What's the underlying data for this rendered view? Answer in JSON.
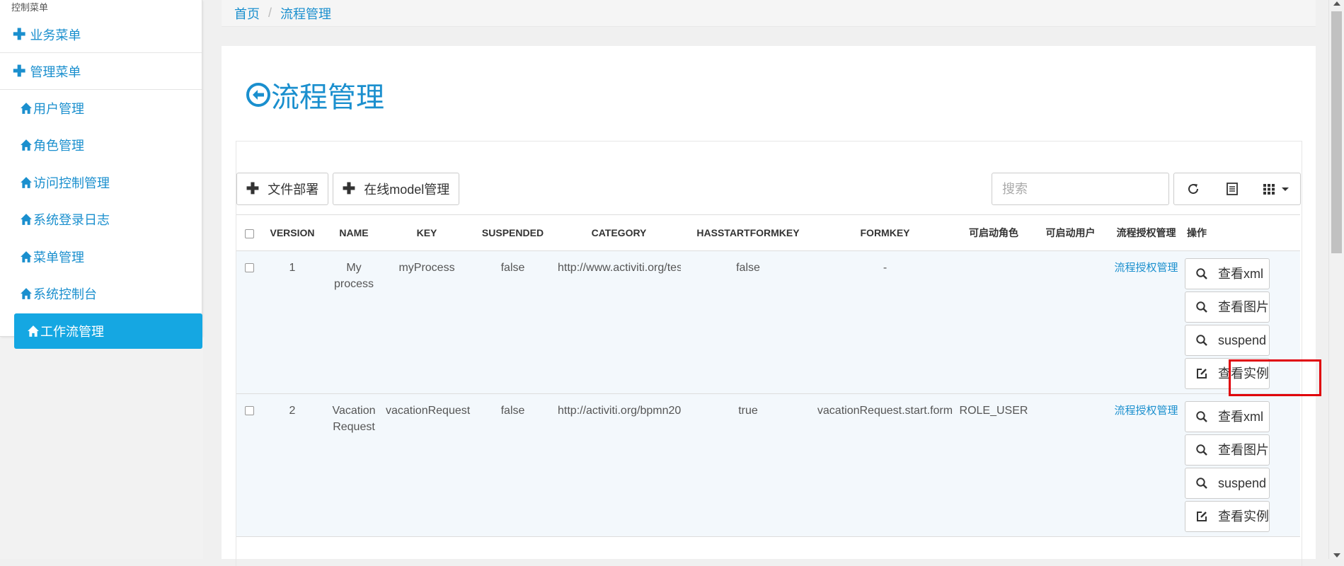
{
  "sidebar": {
    "caption": "控制菜单",
    "groups": [
      {
        "label": "业务菜单"
      },
      {
        "label": "管理菜单"
      }
    ],
    "items": [
      {
        "label": "用户管理"
      },
      {
        "label": "角色管理"
      },
      {
        "label": "访问控制管理"
      },
      {
        "label": "系统登录日志"
      },
      {
        "label": "菜单管理"
      },
      {
        "label": "系统控制台"
      },
      {
        "label": "工作流管理",
        "active": true
      }
    ]
  },
  "breadcrumb": {
    "home": "首页",
    "separator": "/",
    "current": "流程管理"
  },
  "page": {
    "title": "流程管理",
    "title_icon": "circle-arrow-left-icon"
  },
  "toolbar": {
    "deploy_label": "文件部署",
    "model_label": "在线model管理",
    "search_placeholder": "搜索",
    "refresh_icon": "refresh-icon",
    "toggle_view_icon": "list-view-icon",
    "columns_icon": "columns-grid-icon"
  },
  "table": {
    "columns": [
      "VERSION",
      "NAME",
      "KEY",
      "SUSPENDED",
      "CATEGORY",
      "HASSTARTFORMKEY",
      "FORMKEY",
      "可启动角色",
      "可启动用户",
      "流程授权管理",
      "操作"
    ],
    "rows": [
      {
        "version": "1",
        "name": "My process",
        "key": "myProcess",
        "suspended": "false",
        "category": "http://www.activiti.org/test",
        "hasstartformkey": "false",
        "formkey": "-",
        "roles": "",
        "users": "",
        "auth_link": "流程授权管理",
        "ops": [
          "查看xml",
          "查看图片",
          "suspend",
          "查看实例"
        ]
      },
      {
        "version": "2",
        "name": "Vacation Request",
        "key": "vacationRequest",
        "suspended": "false",
        "category": "http://activiti.org/bpmn20",
        "hasstartformkey": "true",
        "formkey": "vacationRequest.start.form",
        "roles": "ROLE_USER",
        "users": "",
        "auth_link": "流程授权管理",
        "ops": [
          "查看xml",
          "查看图片",
          "suspend",
          "查看实例"
        ]
      }
    ]
  },
  "colors": {
    "accent": "#1a8fce",
    "active_menu": "#15a7e2",
    "highlight": "#e0000a"
  }
}
